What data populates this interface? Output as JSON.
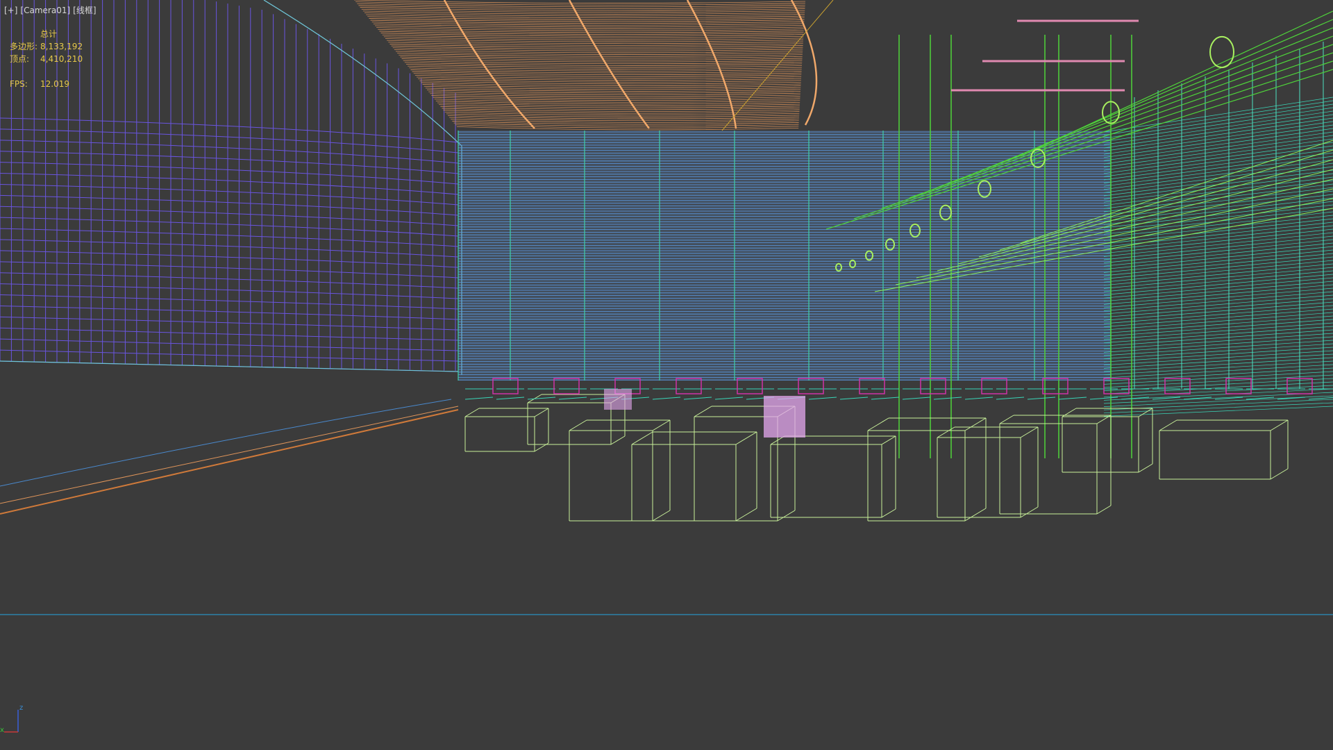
{
  "viewport": {
    "label_plus": "[+]",
    "label_camera": "[Camera01]",
    "label_mode": "[线框]"
  },
  "stats": {
    "header": "总计",
    "polys_label": "多边形:",
    "polys_value": "8,133,192",
    "verts_label": "顶点:",
    "verts_value": "4,410,210",
    "fps_label": "FPS:",
    "fps_value": "12.019"
  },
  "axis": {
    "z_label": "z",
    "x_label": "x"
  },
  "colors": {
    "background": "#3b3b3b",
    "stats_text": "#e6c84a",
    "wall_left": "#6a55e0",
    "wall_center": "#5b9be6",
    "ceiling": "#e0955a",
    "green": "#4fd43a",
    "cyan": "#3ad6b8",
    "furniture": "#c8f09a",
    "magenta": "#d033a8",
    "horizon": "#2a8fc0"
  }
}
